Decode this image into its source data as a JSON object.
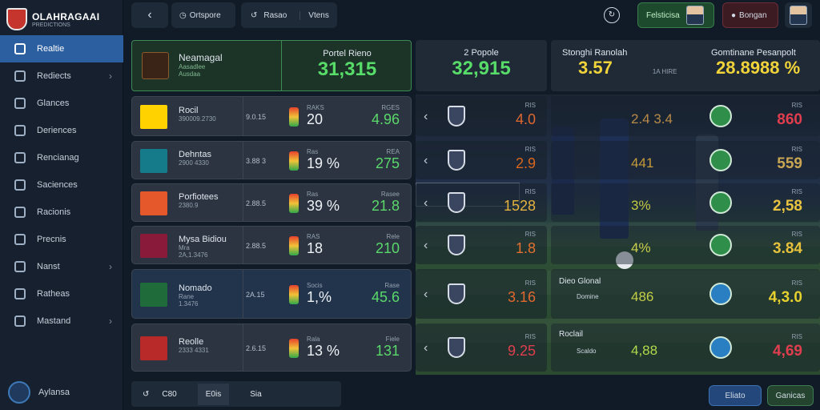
{
  "brand": {
    "title": "OLAHRAGAAI",
    "subtitle": "PREDICTIONS"
  },
  "sidebar": {
    "items": [
      {
        "label": "Realtie",
        "icon": "home-icon",
        "active": true,
        "chevron": false
      },
      {
        "label": "Rediects",
        "icon": "stats-icon",
        "chevron": true
      },
      {
        "label": "Glances",
        "icon": "globe-icon",
        "chevron": false
      },
      {
        "label": "Deriences",
        "icon": "flag-icon",
        "chevron": false
      },
      {
        "label": "Rencianag",
        "icon": "club-icon",
        "chevron": false
      },
      {
        "label": "Saciences",
        "icon": "shield-icon",
        "chevron": false
      },
      {
        "label": "Racionis",
        "icon": "badge-icon",
        "chevron": false
      },
      {
        "label": "Precnis",
        "icon": "ticket-icon",
        "chevron": false
      },
      {
        "label": "Nanst",
        "icon": "flag-icon",
        "chevron": true
      },
      {
        "label": "Ratheas",
        "icon": "ball-icon",
        "chevron": false
      },
      {
        "label": "Mastand",
        "icon": "shield-icon",
        "chevron": true
      }
    ],
    "footer": "Aylansa"
  },
  "topbar": {
    "back": "‹",
    "tab1": "Ortspore",
    "tab2": "Rasao",
    "tab3": "Vtens",
    "btn_green": "Felsticisa",
    "btn_red": "Bongan"
  },
  "summary": {
    "team": "Neamagal",
    "team_sub1": "Aasadlee",
    "team_sub2": "Ausdaa",
    "center_label": "Portel Rieno",
    "center_value": "31,315",
    "mid_label": "2 Popole",
    "mid_value": "32,915",
    "right_label": "Stonghi Ranolah",
    "right_value": "3.57",
    "right_sub": "1A HIRE",
    "far_label": "Gomtinane Pesanpolt",
    "far_value": "28.8988 %"
  },
  "rows": [
    {
      "name": "Rocil",
      "sub": "390009.2730",
      "odds": "9.0.15",
      "mini": "RAKS",
      "val": "20",
      "rlabel": "RGES",
      "rval": "4.96",
      "logo": "#ffd200",
      "mid_val": "4.0",
      "mid_color": "#e0682f",
      "r2": "2.4 3.4",
      "r2c": "#b98a47",
      "r3": "860",
      "r3c": "#e03e4f"
    },
    {
      "name": "Dehntas",
      "sub": "2900 4330",
      "odds": "3.88 3",
      "mini": "Ras",
      "val": "19 %",
      "rlabel": "REA",
      "rval": "275",
      "logo": "#157b8a",
      "mid_val": "2.9",
      "mid_color": "#d8661c",
      "r2": "441",
      "r2c": "#c59a3a",
      "r3": "559",
      "r3c": "#c7a552"
    },
    {
      "name": "Porfiotees",
      "sub": "2380.9",
      "odds": "2.88.5",
      "mini": "Ras",
      "val": "39 %",
      "rlabel": "Rasee",
      "rval": "21.8",
      "logo": "#e5582b",
      "mid_val": "1528",
      "mid_color": "#e5b23f",
      "r2": "3%",
      "r2c": "#c3c844",
      "r3": "2,58",
      "r3c": "#e8c341"
    },
    {
      "name": "Mysa Bidiou",
      "sub": "2A,1.3476",
      "odds": "2.88.5",
      "mini": "RAS",
      "val": "18",
      "rlabel": "Rele",
      "rval": "210",
      "logo": "#8a1a3a",
      "mid_val": "1.8",
      "mid_color": "#e3702e",
      "r2": "4%",
      "r2c": "#c9cf4b",
      "r3": "3.84",
      "r3c": "#e5c13c"
    },
    {
      "name": "Nomado",
      "sub": "1.3476",
      "odds": "2A.15",
      "mini": "Socis",
      "val": "1,%",
      "rlabel": "Rase",
      "rval": "45.6",
      "logo": "#1f6b3a",
      "mid_val": "3.16",
      "mid_color": "#e0682f",
      "r2": "486",
      "r2c": "#c3cf47",
      "r3": "4,3.0",
      "r3c": "#e6d02f"
    },
    {
      "name": "Reolle",
      "sub": "2333 4331",
      "odds": "2.6.15",
      "mini": "Rala",
      "val": "13 %",
      "rlabel": "Fiele",
      "rval": "131",
      "logo": "#b82a2a",
      "mid_val": "9.25",
      "mid_color": "#e03e4f",
      "r2": "4,88",
      "r2c": "#b3d94c",
      "r3": "4,69",
      "r3c": "#e03e4f"
    }
  ],
  "row_extra": {
    "r4_sub": "Mra",
    "r5_sub": "Rane",
    "r5_l": "Dieo Glonal",
    "r5_s": "Domine",
    "r6_l": "Roclail",
    "r6_s": "Scaldo"
  },
  "bottom": {
    "b1": "C80",
    "b2": "E0is",
    "b3": "Sia",
    "act1": "Eliato",
    "act2": "Ganicas"
  },
  "colors": {
    "accent": "#2c5fa0",
    "green": "#56d264",
    "red": "#e03e4f",
    "yellow": "#f1d33a"
  }
}
